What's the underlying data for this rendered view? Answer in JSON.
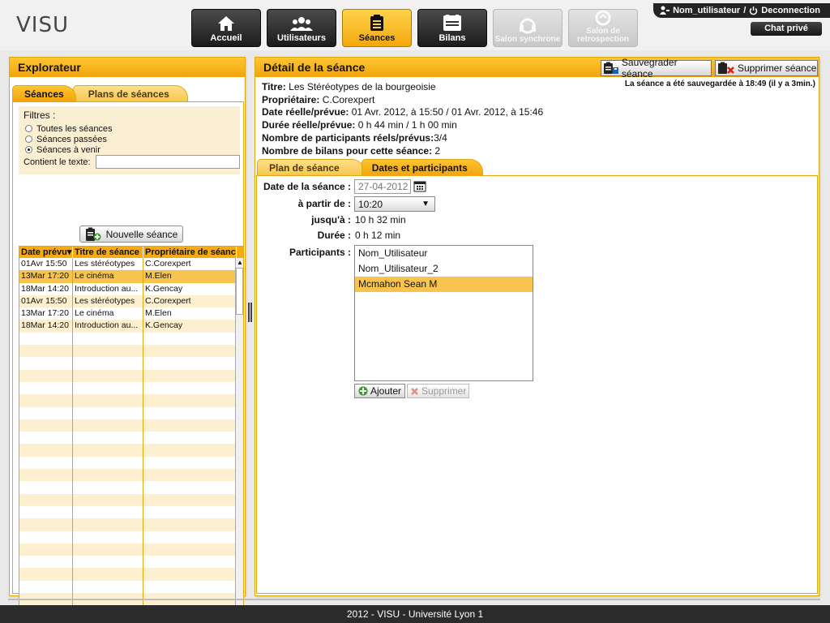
{
  "app": {
    "logo": "VISU"
  },
  "nav": [
    {
      "label": "Accueil",
      "icon": "home-icon",
      "state": "normal"
    },
    {
      "label": "Utilisateurs",
      "icon": "users-icon",
      "state": "normal"
    },
    {
      "label": "Séances",
      "icon": "clipboard-icon",
      "state": "active"
    },
    {
      "label": "Bilans",
      "icon": "report-icon",
      "state": "normal"
    },
    {
      "label": "Salon synchrone",
      "icon": "headset-icon",
      "state": "disabled"
    },
    {
      "label": "Salon de retrospection",
      "icon": "retrospection-icon",
      "state": "disabled"
    }
  ],
  "user": {
    "name": "Nom_utilisateur",
    "separator": "/",
    "logout": "Deconnection"
  },
  "chat": {
    "label": "Chat privé"
  },
  "explorer": {
    "title": "Explorateur",
    "tabs": [
      "Séances",
      "Plans de séances"
    ],
    "filters": {
      "title": "Filtres :",
      "options": [
        "Toutes les séances",
        "Séances passées",
        "Séances à venir"
      ],
      "selected_index": 2,
      "text_label": "Contient le texte:",
      "text_value": ""
    },
    "new_button": "Nouvelle séance",
    "grid": {
      "columns": [
        "Date prévu",
        "Titre de séance",
        "Propriétaire de séance"
      ],
      "sort_indicator": "▾",
      "rows": [
        [
          "01Avr 15:50",
          "Les stéréotypes",
          "C.Corexpert"
        ],
        [
          "13Mar 17:20",
          "Le cinéma",
          "M.Elen"
        ],
        [
          "18Mar 14:20",
          "Introduction au...",
          "K.Gencay"
        ],
        [
          "01Avr 15:50",
          "Les stéréotypes",
          "C.Corexpert"
        ],
        [
          "13Mar 17:20",
          "Le cinéma",
          "M.Elen"
        ],
        [
          "18Mar 14:20",
          "Introduction au...",
          "K.Gencay"
        ]
      ],
      "selected_row": 1
    }
  },
  "detail": {
    "title": "Détail de la séance",
    "save_button": "Sauvegrader séance",
    "delete_button": "Supprimer séance",
    "saved_msg": "La séance a été sauvegardée à 18:49 (il y a 3min.)",
    "info": [
      {
        "label": "Titre:",
        "value": "Les Stéréotypes de la bourgeoisie"
      },
      {
        "label": "Propriétaire:",
        "value": "C.Corexpert"
      },
      {
        "label": "Date réelle/prévue:",
        "value": "01 Avr. 2012, à 15:50 / 01 Avr. 2012, à 15:46"
      },
      {
        "label": "Durée réelle/prévue:",
        "value": "0 h 44 min / 1 h 00 min"
      },
      {
        "label": "Nombre de participants réels/prévus:",
        "value": "3/4"
      },
      {
        "label": "Nombre de bilans pour cette séance:",
        "value": "2"
      }
    ],
    "tabs": [
      "Plan de séance",
      "Dates et participants"
    ],
    "form": {
      "date_label": "Date de la séance :",
      "date_value": "27-04-2012",
      "start_label": "à partir de :",
      "start_value": "10:20",
      "end_label": "jusqu'à :",
      "end_value": "10 h 32 min",
      "duration_label": "Durée :",
      "duration_value": "0 h 12 min",
      "participants_label": "Participants :",
      "participants": [
        "Nom_Utilisateur",
        "Nom_Utilisateur_2",
        "Mcmahon Sean M"
      ],
      "selected_participant": 2,
      "add_button": "Ajouter",
      "remove_button": "Supprimer"
    }
  },
  "footer": {
    "text": "2012 - VISU - Université Lyon 1"
  }
}
